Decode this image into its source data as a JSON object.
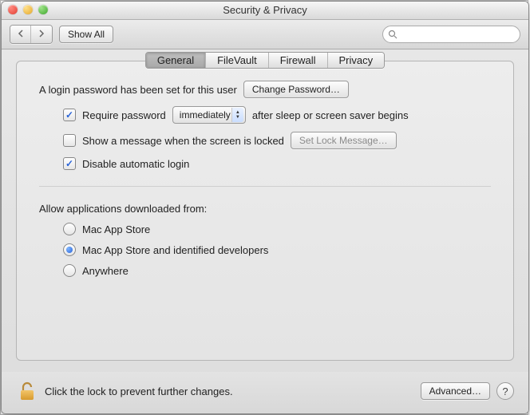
{
  "title": "Security & Privacy",
  "toolbar": {
    "show_all": "Show All",
    "search_placeholder": ""
  },
  "tabs": {
    "general": "General",
    "filevault": "FileVault",
    "firewall": "Firewall",
    "privacy": "Privacy",
    "selected": "general"
  },
  "login": {
    "password_set_text": "A login password has been set for this user",
    "change_password_btn": "Change Password…",
    "require_password_label": "Require password",
    "require_password_checked": true,
    "delay_value": "immediately",
    "after_sleep_text": "after sleep or screen saver begins",
    "show_message_label": "Show a message when the screen is locked",
    "show_message_checked": false,
    "set_lock_message_btn": "Set Lock Message…",
    "disable_auto_login_label": "Disable automatic login",
    "disable_auto_login_checked": true
  },
  "gatekeeper": {
    "heading": "Allow applications downloaded from:",
    "options": {
      "mas": "Mac App Store",
      "mas_dev": "Mac App Store and identified developers",
      "anywhere": "Anywhere"
    },
    "selected": "mas_dev"
  },
  "footer": {
    "lock_text": "Click the lock to prevent further changes.",
    "advanced_btn": "Advanced…"
  }
}
